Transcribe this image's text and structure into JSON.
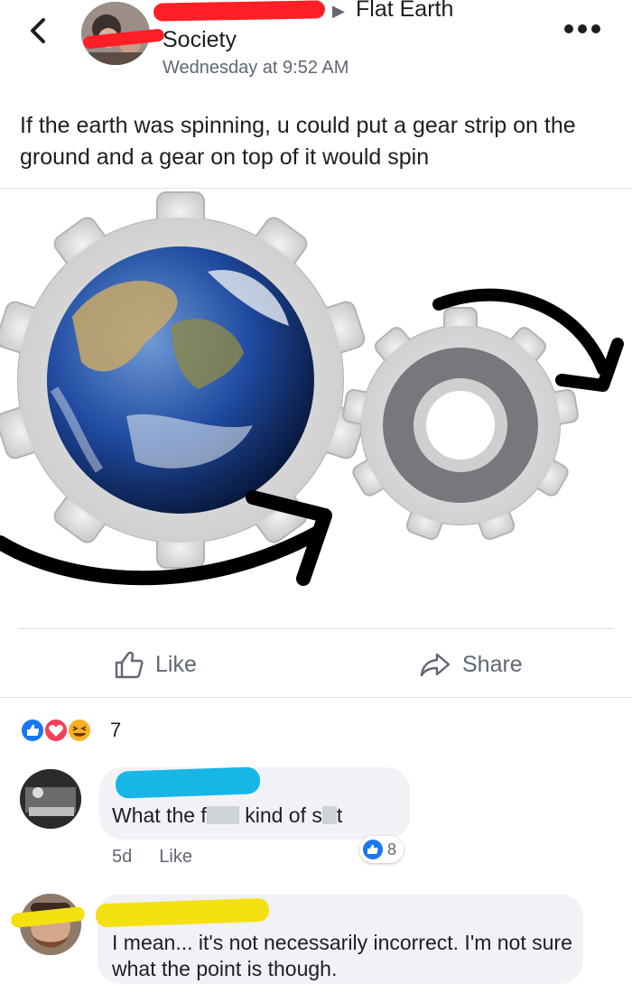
{
  "header": {
    "group_name_line1": "Flat Earth",
    "group_name_line2": "Society",
    "timestamp": "Wednesday at 9:52 AM",
    "back_icon": "chevron-left-icon",
    "more_icon": "more-dots-icon"
  },
  "post": {
    "text": "If the earth was spinning, u could put a gear strip on the ground and a gear on top of it would spin"
  },
  "actions": {
    "like_label": "Like",
    "share_label": "Share"
  },
  "reactions": {
    "count": "7",
    "types": [
      "like",
      "love",
      "haha"
    ]
  },
  "comments": [
    {
      "text_part1": "What the f",
      "text_part2": " kind of s",
      "text_part3": "t",
      "age": "5d",
      "like_label": "Like",
      "likes": "8"
    },
    {
      "text": "I mean... it's not necessarily incorrect. I'm not sure what the point is though."
    }
  ],
  "colors": {
    "redact_red": "#ff1f24",
    "redact_blue": "#16b7e6",
    "redact_yellow": "#f5e011",
    "like_blue": "#1877f2",
    "love_red": "#f33e58",
    "haha_yellow": "#f7b125"
  }
}
